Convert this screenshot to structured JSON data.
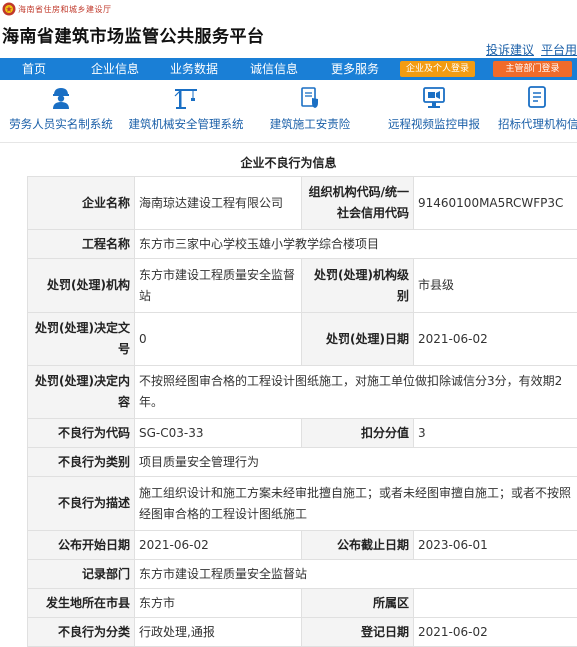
{
  "header": {
    "agency": "海南省住房和城乡建设厅",
    "site_title": "海南省建筑市场监管公共服务平台",
    "complaint_link": "投诉建议",
    "platform_link": "平台用"
  },
  "nav": {
    "items": [
      "首页",
      "企业信息",
      "业务数据",
      "诚信信息",
      "更多服务"
    ],
    "company_login": "企业及个人登录",
    "dept_login": "主管部门登录"
  },
  "features": [
    {
      "label": "劳务人员实名制系统",
      "icon": "worker-icon"
    },
    {
      "label": "建筑机械安全管理系统",
      "icon": "crane-icon"
    },
    {
      "label": "建筑施工安责险",
      "icon": "insurance-icon"
    },
    {
      "label": "远程视频监控申报",
      "icon": "video-monitor-icon"
    },
    {
      "label": "招标代理机构信",
      "icon": "document-icon"
    }
  ],
  "section_title": "企业不良行为信息",
  "record": {
    "company_name_label": "企业名称",
    "company_name": "海南琼达建设工程有限公司",
    "org_code_label": "组织机构代码/统一社会信用代码",
    "org_code": "91460100MA5RCWFP3C",
    "project_label": "工程名称",
    "project": "东方市三家中心学校玉雄小学教学综合楼项目",
    "penalty_org_label": "处罚(处理)机构",
    "penalty_org": "东方市建设工程质量安全监督站",
    "penalty_level_label": "处罚(处理)机构级别",
    "penalty_level": "市县级",
    "decision_no_label": "处罚(处理)决定文号",
    "decision_no": "0",
    "penalty_date_label": "处罚(处理)日期",
    "penalty_date": "2021-06-02",
    "decision_content_label": "处罚(处理)决定内容",
    "decision_content": "不按照经图审合格的工程设计图纸施工，对施工单位做扣除诚信分3分，有效期2年。",
    "behavior_code_label": "不良行为代码",
    "behavior_code": "SG-C03-33",
    "deduct_label": "扣分分值",
    "deduct": "3",
    "category_label": "不良行为类别",
    "category": "项目质量安全管理行为",
    "description_label": "不良行为描述",
    "description": "施工组织设计和施工方案未经审批擅自施工；或者未经图审擅自施工；或者不按照经图审合格的工程设计图纸施工",
    "publish_start_label": "公布开始日期",
    "publish_start": "2021-06-02",
    "publish_end_label": "公布截止日期",
    "publish_end": "2023-06-01",
    "record_dept_label": "记录部门",
    "record_dept": "东方市建设工程质量安全监督站",
    "city_label": "发生地所在市县",
    "city": "东方市",
    "district_label": "所属区",
    "district": "",
    "classification_label": "不良行为分类",
    "classification": "行政处理,通报",
    "register_date_label": "登记日期",
    "register_date": "2021-06-02"
  },
  "colors": {
    "nav_bg": "#1a7fd6",
    "company_login_bg": "#f39c12",
    "dept_login_bg": "#f06b2a",
    "link": "#1a5fa8",
    "label_bg": "#f4f4f4"
  }
}
